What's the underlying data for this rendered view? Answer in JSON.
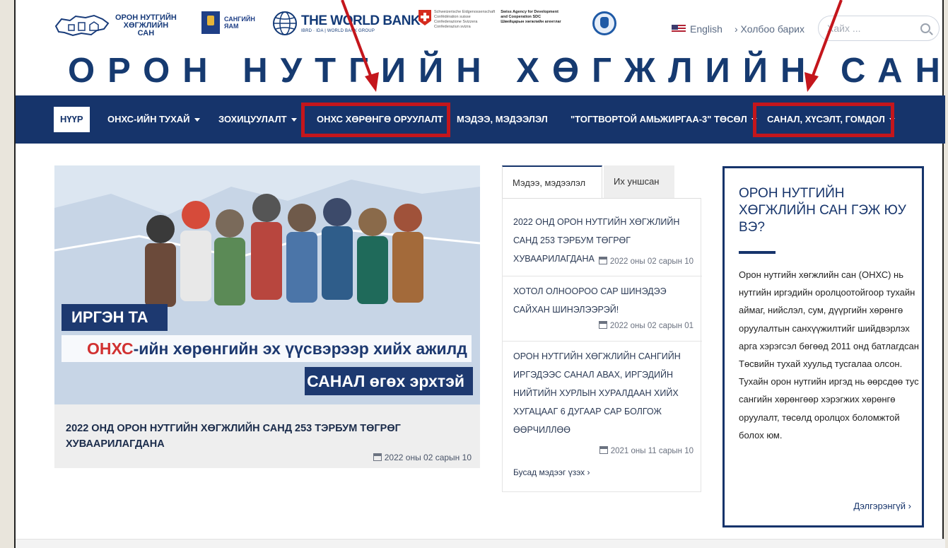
{
  "header": {
    "onxs_logo": {
      "line1": "ОРОН НУТГИЙН",
      "line2": "ХӨГЖЛИЙН",
      "line3": "САН"
    },
    "ministry_logo": {
      "line1": "САНГИЙН",
      "line2": "ЯАМ"
    },
    "worldbank_logo": {
      "title": "THE WORLD BANK",
      "subtitle": "IBRD · IDA | WORLD BANK GROUP"
    },
    "swiss_logo": {
      "lines": [
        "Schweizerische Eidgenossenschaft",
        "Confédération suisse",
        "Confederazione Svizzera",
        "Confederaziun svizra"
      ],
      "sdc_lines": [
        "Swiss Agency for Development",
        "and Cooperation SDC",
        "Швейцарын хөгжлийн агентлаг"
      ]
    },
    "language_label": "English",
    "contact_label": "› Холбоо барих",
    "search_placeholder": "Хайх ...",
    "site_title": "ОРОН НУТГИЙН ХӨГЖЛИЙН САН"
  },
  "nav": {
    "items": [
      {
        "label": "НҮҮР"
      },
      {
        "label": "ОНХС-ИЙН ТУХАЙ"
      },
      {
        "label": "ЗОХИЦУУЛАЛТ"
      },
      {
        "label": "ОНХС ХӨРӨНГӨ ОРУУЛАЛТ"
      },
      {
        "label": "МЭДЭЭ, МЭДЭЭЛЭЛ"
      },
      {
        "label": "\"ТОГТВОРТОЙ АМЬЖИРГАА-3\" ТӨСӨЛ"
      },
      {
        "label": "САНАЛ, ХҮСЭЛТ, ГОМДОЛ"
      }
    ]
  },
  "featured": {
    "banner_1": "ИРГЭН ТА",
    "banner_2_red": "ОНХС",
    "banner_2_rest": "-ийн хөрөнгийн эх үүсвэрээр хийх ажилд",
    "banner_3": "САНАЛ өгөх эрхтэй",
    "title": "2022 ОНД ОРОН НУТГИЙН ХӨГЖЛИЙН САНД 253 ТЭРБУМ ТӨГРӨГ ХУВААРИЛАГДАНА",
    "date": "2022 оны 02 сарын 10"
  },
  "news": {
    "tabs": [
      "Мэдээ, мэдээлэл",
      "Их уншсан"
    ],
    "items": [
      {
        "title": "2022 ОНД ОРОН НУТГИЙН ХӨГЖЛИЙН САНД 253 ТЭРБУМ ТӨГРӨГ ХУВААРИЛАГДАНА",
        "date": "2022 оны 02 сарын 10"
      },
      {
        "title": "ХОТОЛ ОЛНООРОО САР ШИНЭДЭЭ САЙХАН ШИНЭЛЭЭРЭЙ!",
        "date": "2022 оны 02 сарын 01"
      },
      {
        "title": "ОРОН НУТГИЙН ХӨГЖЛИЙН САНГИЙН ИРГЭДЭЭС САНАЛ АВАХ, ИРГЭДИЙН НИЙТИЙН ХУРЛЫН ХУРАЛДААН ХИЙХ ХУГАЦААГ 6 ДУГААР САР БОЛГОЖ ӨӨРЧИЛЛӨӨ",
        "date": "2021 оны 11 сарын 10"
      }
    ],
    "more_label": "Бусад мэдээг үзэх ›"
  },
  "about": {
    "title": "ОРОН НУТГИЙН ХӨГЖЛИЙН САН ГЭЖ ЮУ ВЭ?",
    "text": "Орон нутгийн хөгжлийн сан (ОНХС) нь нутгийн иргэдийн оролцоотойгоор тухайн аймаг, нийслэл, сум, дүүргийн хөрөнгө оруулалтын санхүүжилтийг шийдвэрлэх арга хэрэгсэл бөгөөд 2011 онд батлагдсан Төсвийн тухай хуульд тусгалаа олсон. Тухайн орон нутгийн иргэд нь өөрсдөө тус сангийн хөрөнгөөр хэрэгжих хөрөнгө оруулалт, төсөлд оролцох боломжтой болох юм.",
    "more_label": "Дэлгэрэнгүй ›"
  },
  "colors": {
    "nav_bg": "#16346b",
    "title_blue": "#163a70",
    "highlight_red": "#c4161c"
  }
}
